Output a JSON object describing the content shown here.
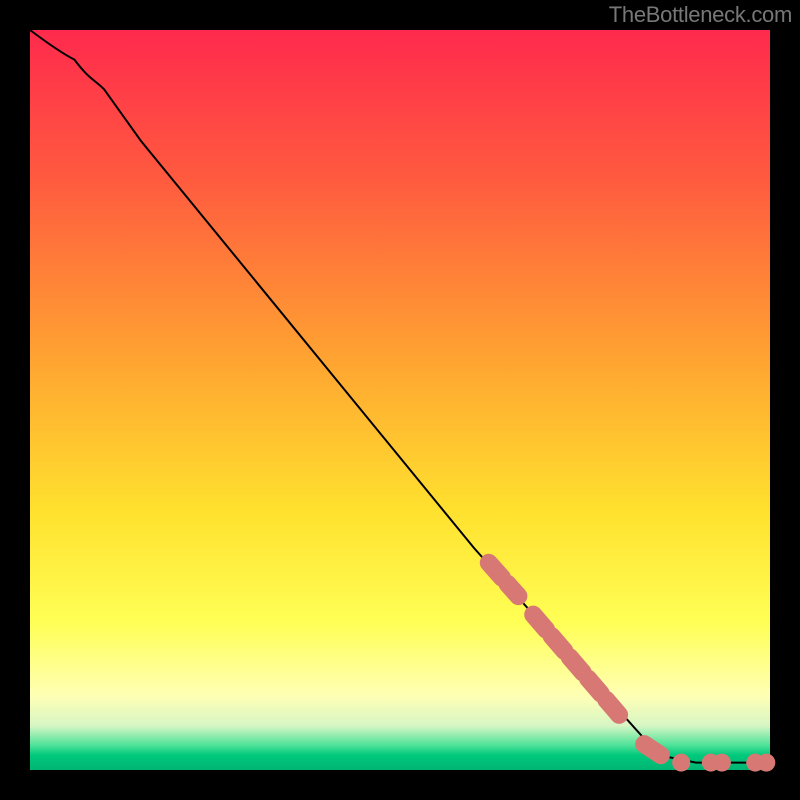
{
  "attribution": "TheBottleneck.com",
  "chart_data": {
    "type": "line",
    "title": "",
    "xlabel": "",
    "ylabel": "",
    "xlim": [
      0,
      100
    ],
    "ylim": [
      0,
      100
    ],
    "grid": false,
    "legend": false,
    "series": [
      {
        "name": "curve",
        "style": "line",
        "color": "#000000",
        "points": [
          {
            "x": 0,
            "y": 100
          },
          {
            "x": 6,
            "y": 96
          },
          {
            "x": 10,
            "y": 92
          },
          {
            "x": 15,
            "y": 85
          },
          {
            "x": 60,
            "y": 30
          },
          {
            "x": 85,
            "y": 2
          },
          {
            "x": 90,
            "y": 1
          },
          {
            "x": 95,
            "y": 1
          },
          {
            "x": 98,
            "y": 1
          },
          {
            "x": 100,
            "y": 1
          }
        ]
      },
      {
        "name": "highlighted-segment-upper",
        "style": "thick-dashed",
        "color": "#d77874",
        "points": [
          {
            "x": 62,
            "y": 28
          },
          {
            "x": 66,
            "y": 23.5
          }
        ]
      },
      {
        "name": "highlighted-segment-mid",
        "style": "thick-dashed",
        "color": "#d77874",
        "points": [
          {
            "x": 68,
            "y": 21
          },
          {
            "x": 80,
            "y": 7
          }
        ]
      },
      {
        "name": "highlighted-segment-low",
        "style": "thick-dashed",
        "color": "#d77874",
        "points": [
          {
            "x": 83,
            "y": 3.5
          },
          {
            "x": 86,
            "y": 1.5
          }
        ]
      },
      {
        "name": "tail-dots",
        "style": "dots",
        "color": "#d77874",
        "points": [
          {
            "x": 88,
            "y": 1
          },
          {
            "x": 92,
            "y": 1
          },
          {
            "x": 93.5,
            "y": 1
          },
          {
            "x": 98,
            "y": 1
          },
          {
            "x": 99.5,
            "y": 1
          }
        ]
      }
    ],
    "background_gradient": {
      "stops": [
        {
          "offset": 0.0,
          "color": "#ff2a4d"
        },
        {
          "offset": 0.2,
          "color": "#ff5a3f"
        },
        {
          "offset": 0.45,
          "color": "#ffa531"
        },
        {
          "offset": 0.65,
          "color": "#ffe12e"
        },
        {
          "offset": 0.8,
          "color": "#ffff55"
        },
        {
          "offset": 0.9,
          "color": "#ffffb5"
        },
        {
          "offset": 0.94,
          "color": "#d7f6c4"
        },
        {
          "offset": 0.965,
          "color": "#56e49b"
        },
        {
          "offset": 0.98,
          "color": "#00c97c"
        },
        {
          "offset": 1.0,
          "color": "#00b473"
        }
      ]
    },
    "frame": {
      "outer_size": 800,
      "inner_margin": 30,
      "border_color": "#000000"
    }
  }
}
